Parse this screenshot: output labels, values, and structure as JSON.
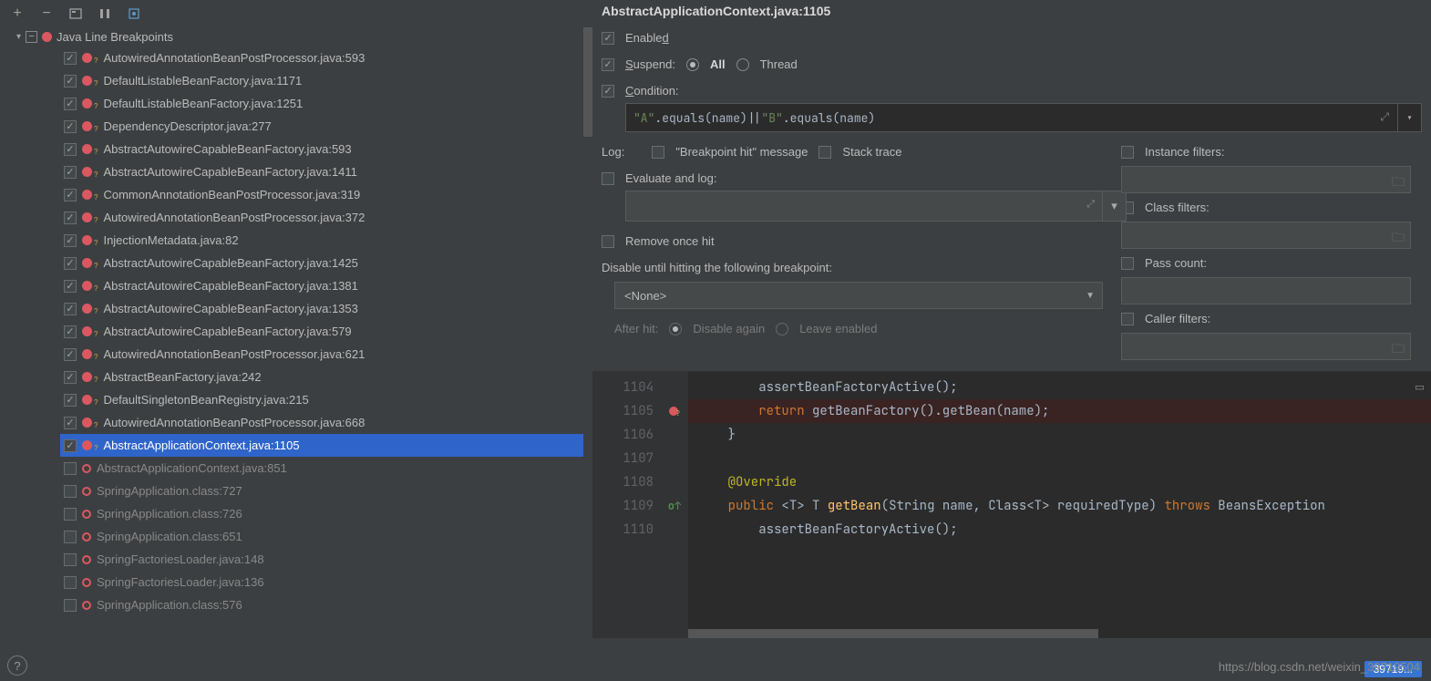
{
  "toolbar": {
    "add": "+",
    "remove": "−"
  },
  "tree": {
    "root_label": "Java Line Breakpoints",
    "items": [
      {
        "checked": true,
        "style": "solid-q",
        "label": "AutowiredAnnotationBeanPostProcessor.java:593",
        "dim": false
      },
      {
        "checked": true,
        "style": "solid-q",
        "label": "DefaultListableBeanFactory.java:1171",
        "dim": false
      },
      {
        "checked": true,
        "style": "solid-q",
        "label": "DefaultListableBeanFactory.java:1251",
        "dim": false
      },
      {
        "checked": true,
        "style": "solid-q",
        "label": "DependencyDescriptor.java:277",
        "dim": false
      },
      {
        "checked": true,
        "style": "solid-q",
        "label": "AbstractAutowireCapableBeanFactory.java:593",
        "dim": false
      },
      {
        "checked": true,
        "style": "solid-q",
        "label": "AbstractAutowireCapableBeanFactory.java:1411",
        "dim": false
      },
      {
        "checked": true,
        "style": "solid-q",
        "label": "CommonAnnotationBeanPostProcessor.java:319",
        "dim": false
      },
      {
        "checked": true,
        "style": "solid-q",
        "label": "AutowiredAnnotationBeanPostProcessor.java:372",
        "dim": false
      },
      {
        "checked": true,
        "style": "solid-q",
        "label": "InjectionMetadata.java:82",
        "dim": false
      },
      {
        "checked": true,
        "style": "solid-q",
        "label": "AbstractAutowireCapableBeanFactory.java:1425",
        "dim": false
      },
      {
        "checked": true,
        "style": "solid-q",
        "label": "AbstractAutowireCapableBeanFactory.java:1381",
        "dim": false
      },
      {
        "checked": true,
        "style": "solid-q",
        "label": "AbstractAutowireCapableBeanFactory.java:1353",
        "dim": false
      },
      {
        "checked": true,
        "style": "solid-q",
        "label": "AbstractAutowireCapableBeanFactory.java:579",
        "dim": false
      },
      {
        "checked": true,
        "style": "solid-q",
        "label": "AutowiredAnnotationBeanPostProcessor.java:621",
        "dim": false
      },
      {
        "checked": true,
        "style": "solid-q",
        "label": "AbstractBeanFactory.java:242",
        "dim": false
      },
      {
        "checked": true,
        "style": "solid-q",
        "label": "DefaultSingletonBeanRegistry.java:215",
        "dim": false
      },
      {
        "checked": true,
        "style": "solid-q",
        "label": "AutowiredAnnotationBeanPostProcessor.java:668",
        "dim": false
      },
      {
        "checked": true,
        "style": "solid-q",
        "label": "AbstractApplicationContext.java:1105",
        "dim": false,
        "selected": true
      },
      {
        "checked": false,
        "style": "ring",
        "label": "AbstractApplicationContext.java:851",
        "dim": true
      },
      {
        "checked": false,
        "style": "ring",
        "label": "SpringApplication.class:727",
        "dim": true
      },
      {
        "checked": false,
        "style": "ring",
        "label": "SpringApplication.class:726",
        "dim": true
      },
      {
        "checked": false,
        "style": "ring",
        "label": "SpringApplication.class:651",
        "dim": true
      },
      {
        "checked": false,
        "style": "ring",
        "label": "SpringFactoriesLoader.java:148",
        "dim": true
      },
      {
        "checked": false,
        "style": "ring",
        "label": "SpringFactoriesLoader.java:136",
        "dim": true
      },
      {
        "checked": false,
        "style": "ring",
        "label": "SpringApplication.class:576",
        "dim": true
      }
    ]
  },
  "details": {
    "title": "AbstractApplicationContext.java:1105",
    "enabled_label": "Enabled",
    "suspend_label": "Suspend:",
    "suspend_all": "All",
    "suspend_thread": "Thread",
    "condition_label": "Condition:",
    "condition_code": {
      "a": "\"A\"",
      "eq1": ".equals(name)|| ",
      "b": "\"B\"",
      "eq2": ".equals(name)"
    },
    "log_label": "Log:",
    "log_msg": "\"Breakpoint hit\" message",
    "log_stack": "Stack trace",
    "eval_label": "Evaluate and log:",
    "remove_label": "Remove once hit",
    "disable_until_label": "Disable until hitting the following breakpoint:",
    "disable_select": "<None>",
    "after_hit_label": "After hit:",
    "after_disable": "Disable again",
    "after_leave": "Leave enabled",
    "instance_filters": "Instance filters:",
    "class_filters": "Class filters:",
    "pass_count": "Pass count:",
    "caller_filters": "Caller filters:"
  },
  "code": {
    "lines": [
      {
        "n": "1104",
        "mark": "",
        "html": "        assertBeanFactoryActive();"
      },
      {
        "n": "1105",
        "mark": "bp",
        "html": "        <span class='kw'>return</span> getBeanFactory().getBean(name);",
        "hl": true
      },
      {
        "n": "1106",
        "mark": "",
        "html": "    }"
      },
      {
        "n": "1107",
        "mark": "",
        "html": ""
      },
      {
        "n": "1108",
        "mark": "",
        "html": "    <span class='ann'>@Override</span>"
      },
      {
        "n": "1109",
        "mark": "ov",
        "html": "    <span class='kw'>public</span> &lt;<span class='ty'>T</span>&gt; <span class='ty'>T</span> <span class='fn'>getBean</span>(String name, Class&lt;<span class='ty'>T</span>&gt; requiredType) <span class='kw'>throws</span> BeansException"
      },
      {
        "n": "1110",
        "mark": "",
        "html": "        assertBeanFactoryActive();"
      }
    ]
  },
  "watermark": "https://blog.csdn.net/weixin_39719504",
  "badge": "39719..."
}
